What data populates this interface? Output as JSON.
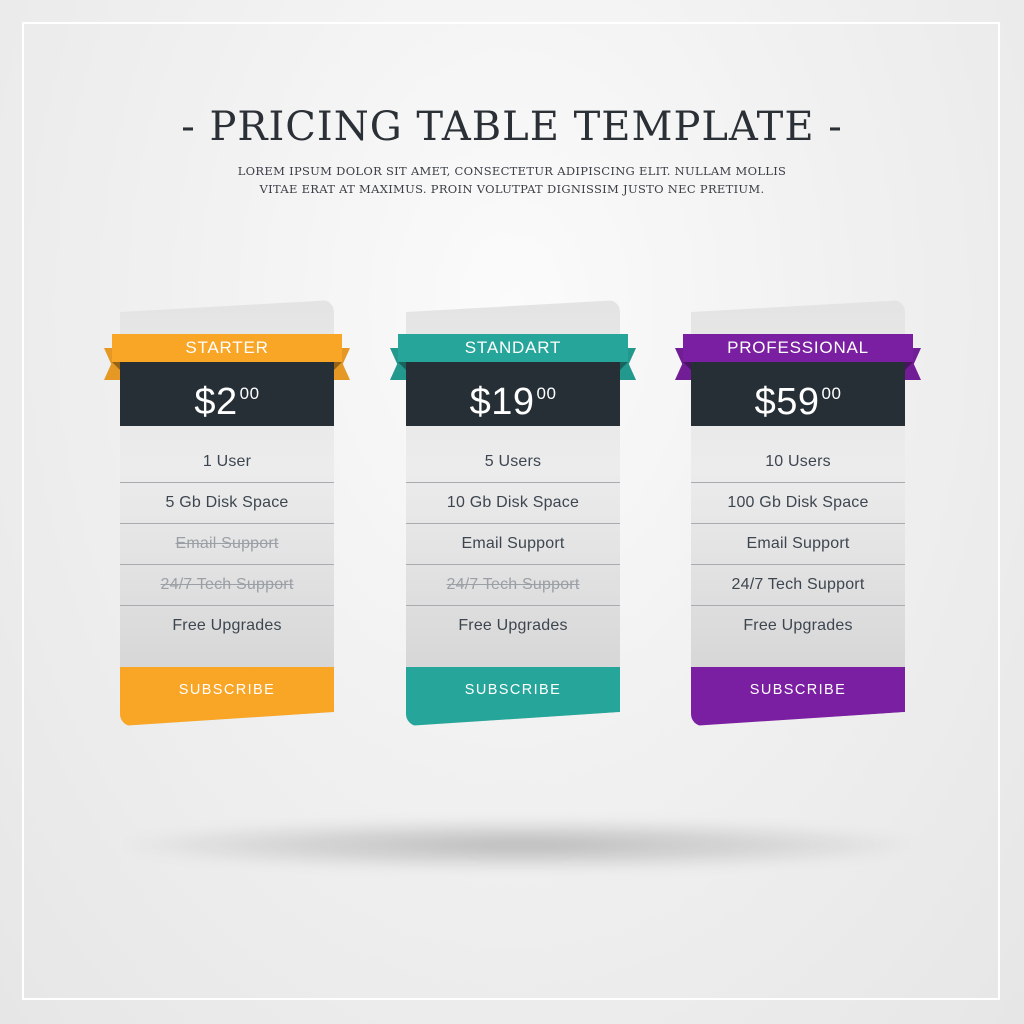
{
  "header": {
    "title": "- PRICING TABLE TEMPLATE -",
    "subtitle_line1": "LOREM IPSUM DOLOR SIT AMET, CONSECTETUR ADIPISCING ELIT. NULLAM MOLLIS",
    "subtitle_line2": "VITAE ERAT AT MAXIMUS. PROIN VOLUTPAT DIGNISSIM JUSTO NEC PRETIUM."
  },
  "plans": [
    {
      "name": "STARTER",
      "currency": "$",
      "price": "2",
      "cents": "00",
      "accent": "#f9a526",
      "features": [
        {
          "label": "1 User",
          "included": true
        },
        {
          "label": "5 Gb Disk Space",
          "included": true
        },
        {
          "label": "Email Support",
          "included": false
        },
        {
          "label": "24/7 Tech Support",
          "included": false
        },
        {
          "label": "Free Upgrades",
          "included": true
        }
      ],
      "button": "SUBSCRIBE"
    },
    {
      "name": "STANDART",
      "currency": "$",
      "price": "19",
      "cents": "00",
      "accent": "#26a69a",
      "features": [
        {
          "label": "5 Users",
          "included": true
        },
        {
          "label": "10 Gb Disk Space",
          "included": true
        },
        {
          "label": "Email Support",
          "included": true
        },
        {
          "label": "24/7 Tech Support",
          "included": false
        },
        {
          "label": "Free Upgrades",
          "included": true
        }
      ],
      "button": "SUBSCRIBE"
    },
    {
      "name": "PROFESSIONAL",
      "currency": "$",
      "price": "59",
      "cents": "00",
      "accent": "#7b1fa2",
      "features": [
        {
          "label": "10 Users",
          "included": true
        },
        {
          "label": "100 Gb Disk Space",
          "included": true
        },
        {
          "label": "Email Support",
          "included": true
        },
        {
          "label": "24/7 Tech Support",
          "included": true
        },
        {
          "label": "Free Upgrades",
          "included": true
        }
      ],
      "button": "SUBSCRIBE"
    }
  ],
  "colors": {
    "dark_band": "#262f36",
    "text_dark": "#3d4650",
    "text_disabled": "#9aa0a6"
  }
}
